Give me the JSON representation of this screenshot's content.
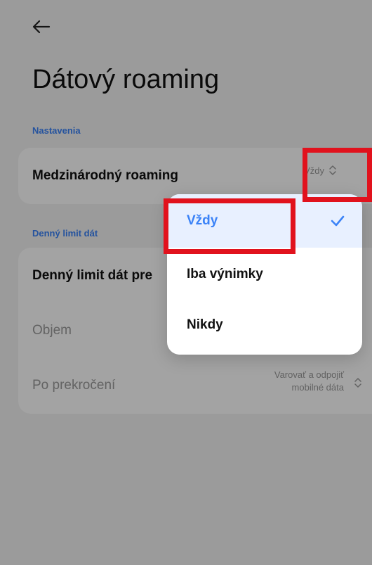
{
  "page": {
    "title": "Dátový roaming"
  },
  "sections": [
    {
      "label": "Nastavenia",
      "rows": [
        {
          "label": "Medzinárodný roaming",
          "value": "Vždy"
        }
      ]
    },
    {
      "label": "Denný limit dát",
      "rows": [
        {
          "label": "Denný limit dát pre"
        },
        {
          "label": "Objem"
        },
        {
          "label": "Po prekročení",
          "value_line1": "Varovať a odpojiť",
          "value_line2": "mobilné dáta"
        }
      ]
    }
  ],
  "menu": {
    "options": [
      {
        "label": "Vždy",
        "selected": true
      },
      {
        "label": "Iba výnimky",
        "selected": false
      },
      {
        "label": "Nikdy",
        "selected": false
      }
    ]
  },
  "colors": {
    "accent": "#3a82f7",
    "highlight": "#e1121d"
  },
  "icons": {
    "back": "back-arrow-icon",
    "check": "checkmark-icon",
    "updown": "chevron-up-down-icon"
  }
}
